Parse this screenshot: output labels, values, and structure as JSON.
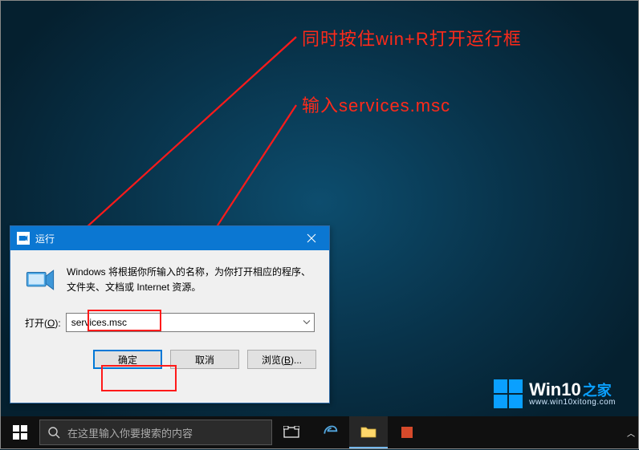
{
  "annotations": {
    "line1": "同时按住win+R打开运行框",
    "line2": "输入services.msc"
  },
  "run_dialog": {
    "title": "运行",
    "description": "Windows 将根据你所输入的名称，为你打开相应的程序、文件夹、文档或 Internet 资源。",
    "open_label_prefix": "打开(",
    "open_label_key": "O",
    "open_label_suffix": "):",
    "input_value": "services.msc",
    "buttons": {
      "ok": "确定",
      "cancel": "取消",
      "browse_prefix": "浏览(",
      "browse_key": "B",
      "browse_suffix": ")..."
    }
  },
  "taskbar": {
    "search_placeholder": "在这里输入你要搜索的内容"
  },
  "watermark": {
    "brand_main": "Win10",
    "brand_sub": "之家",
    "url": "www.win10xitong.com"
  }
}
